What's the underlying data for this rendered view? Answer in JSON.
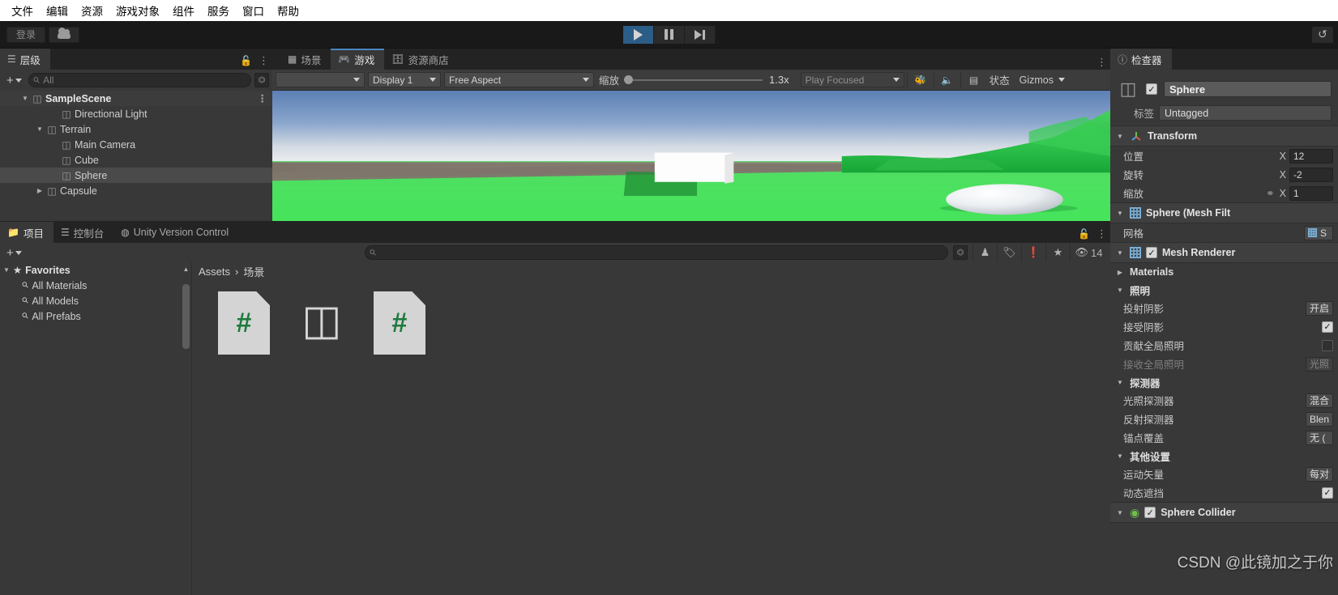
{
  "menubar": {
    "items": [
      "文件",
      "编辑",
      "资源",
      "游戏对象",
      "组件",
      "服务",
      "窗口",
      "帮助"
    ]
  },
  "toolbar": {
    "signin_label": "登录",
    "cloud_icon": "cloud-icon",
    "play_icon": "play-icon",
    "pause_icon": "pause-icon",
    "step_icon": "step-forward-icon",
    "history_icon": "undo-history-icon"
  },
  "hierarchy": {
    "tab_label": "层级",
    "tab_icon": "hierarchy-icon",
    "search_placeholder": "All",
    "add_label": "+",
    "items": [
      {
        "label": "SampleScene",
        "depth": 0,
        "arrow": "▼",
        "icon": "unity-scene-icon",
        "selected": false,
        "scene": true
      },
      {
        "label": "Directional Light",
        "depth": 2,
        "arrow": "",
        "icon": "gameobject-icon",
        "selected": false
      },
      {
        "label": "Terrain",
        "depth": 1,
        "arrow": "▼",
        "icon": "gameobject-icon",
        "selected": false
      },
      {
        "label": "Main Camera",
        "depth": 2,
        "arrow": "",
        "icon": "gameobject-icon",
        "selected": false
      },
      {
        "label": "Cube",
        "depth": 2,
        "arrow": "",
        "icon": "gameobject-icon",
        "selected": false
      },
      {
        "label": "Sphere",
        "depth": 2,
        "arrow": "",
        "icon": "gameobject-icon",
        "selected": true
      },
      {
        "label": "Capsule",
        "depth": 1,
        "arrow": "▶",
        "icon": "gameobject-icon",
        "selected": false
      }
    ]
  },
  "gameview": {
    "tabs": [
      {
        "label": "场景",
        "icon": "grid-icon",
        "active": false
      },
      {
        "label": "游戏",
        "icon": "gamepad-icon",
        "active": true
      },
      {
        "label": "资源商店",
        "icon": "store-bag-icon",
        "active": false
      }
    ],
    "display": "Display 1",
    "aspect": "Free Aspect",
    "scale_label": "缩放",
    "scale_value": "1.3x",
    "play_mode": "Play Focused",
    "stats_label": "状态",
    "gizmos_label": "Gizmos",
    "mute_icon": "audio-icon",
    "bug_icon": "bug-icon",
    "frame_icon": "frame-debugger-icon"
  },
  "inspector": {
    "tab_label": "检查器",
    "tab_icon": "info-icon",
    "object_name": "Sphere",
    "object_enabled": true,
    "tag_label": "标签",
    "tag_value": "Untagged",
    "transform": {
      "title": "Transform",
      "icon": "transform-axes-icon",
      "rows": [
        {
          "label": "位置",
          "axis": "X",
          "value": "12"
        },
        {
          "label": "旋转",
          "axis": "X",
          "value": "-2"
        },
        {
          "label": "缩放",
          "axis": "X",
          "value": "1",
          "link_icon": "link-broken-icon"
        }
      ]
    },
    "mesh_filter": {
      "title": "Sphere (Mesh Filt",
      "icon": "mesh-filter-icon",
      "mesh_label": "网格",
      "mesh_value": "S"
    },
    "mesh_renderer": {
      "title": "Mesh Renderer",
      "icon": "mesh-renderer-icon",
      "enabled": true,
      "materials_label": "Materials",
      "lighting_label": "照明",
      "rows": [
        {
          "label": "投射阴影",
          "value": "开启",
          "type": "dropdown"
        },
        {
          "label": "接受阴影",
          "value": "",
          "type": "checkbox",
          "checked": true
        },
        {
          "label": "贡献全局照明",
          "value": "",
          "type": "checkbox",
          "checked": false
        },
        {
          "label": "接收全局照明",
          "value": "光照",
          "type": "dropdown",
          "dim": true
        }
      ],
      "probes_label": "探测器",
      "probe_rows": [
        {
          "label": "光照探测器",
          "value": "混合"
        },
        {
          "label": "反射探测器",
          "value": "Blen"
        },
        {
          "label": "锚点覆盖",
          "value": "无 ("
        }
      ],
      "other_label": "其他设置",
      "other_rows": [
        {
          "label": "运动矢量",
          "value": "每对",
          "type": "dropdown"
        },
        {
          "label": "动态遮挡",
          "value": "",
          "type": "checkbox",
          "checked": true
        }
      ]
    },
    "sphere_collider": {
      "title": "Sphere Collider",
      "icon": "collider-icon",
      "enabled": true
    }
  },
  "project": {
    "tabs": [
      {
        "label": "项目",
        "icon": "folder-icon",
        "active": true
      },
      {
        "label": "控制台",
        "icon": "console-icon",
        "active": false
      },
      {
        "label": "Unity Version Control",
        "icon": "version-control-icon",
        "active": false
      }
    ],
    "add_label": "+",
    "search_placeholder": "",
    "icons": [
      "search-expand-icon",
      "ai-assist-icon",
      "tag-icon",
      "warning-icon",
      "star-icon"
    ],
    "hidden_count": "14",
    "hidden_icon": "eye-slash-icon",
    "favorites": {
      "title": "Favorites",
      "star_icon": "star-icon",
      "items": [
        "All Materials",
        "All Models",
        "All Prefabs"
      ]
    },
    "breadcrumb": [
      "Assets",
      "场景"
    ],
    "assets": [
      {
        "label": "",
        "type": "csharp-file-icon",
        "glyph": "#"
      },
      {
        "label": "",
        "type": "unity-scene-file-icon",
        "glyph": "U"
      },
      {
        "label": "",
        "type": "csharp-file-icon",
        "glyph": "#"
      }
    ]
  },
  "watermark": "CSDN @此镜加之于你"
}
